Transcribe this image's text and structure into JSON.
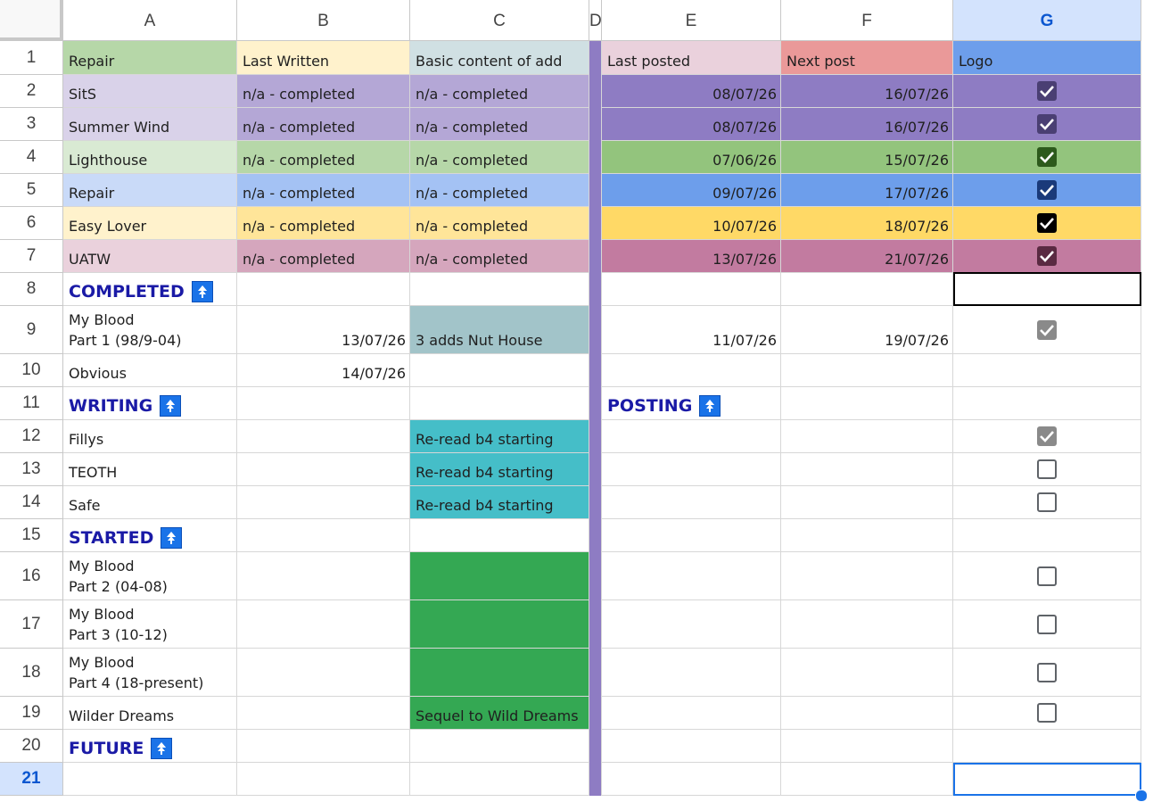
{
  "columns": [
    "A",
    "B",
    "C",
    "D",
    "E",
    "F",
    "G"
  ],
  "selected_column": "G",
  "selected_row": "21",
  "rows": [
    "1",
    "2",
    "3",
    "4",
    "5",
    "6",
    "7",
    "8",
    "9",
    "10",
    "11",
    "12",
    "13",
    "14",
    "15",
    "16",
    "17",
    "18",
    "19",
    "20",
    "21"
  ],
  "header_row": {
    "repair": "Repair",
    "last_written": "Last Written",
    "basic_content": "Basic content of add",
    "last_posted": "Last posted",
    "next_post": "Next post",
    "logo": "Logo"
  },
  "entries": [
    {
      "name": "SitS",
      "written": "n/a - completed",
      "content": "n/a - completed",
      "last_posted": "08/07/26",
      "next_post": "16/07/26",
      "logo": "checked-purple"
    },
    {
      "name": "Summer Wind",
      "written": "n/a - completed",
      "content": "n/a - completed",
      "last_posted": "08/07/26",
      "next_post": "16/07/26",
      "logo": "checked-purple"
    },
    {
      "name": "Lighthouse",
      "written": "n/a - completed",
      "content": "n/a - completed",
      "last_posted": "07/06/26",
      "next_post": "15/07/26",
      "logo": "checked-green"
    },
    {
      "name": "Repair",
      "written": "n/a - completed",
      "content": "n/a - completed",
      "last_posted": "09/07/26",
      "next_post": "17/07/26",
      "logo": "checked-blue"
    },
    {
      "name": "Easy Lover",
      "written": "n/a - completed",
      "content": "n/a - completed",
      "last_posted": "10/07/26",
      "next_post": "18/07/26",
      "logo": "checked-black"
    },
    {
      "name": "UATW",
      "written": "n/a - completed",
      "content": "n/a - completed",
      "last_posted": "13/07/26",
      "next_post": "21/07/26",
      "logo": "checked-mauve"
    }
  ],
  "sections": {
    "completed": "COMPLETED",
    "writing": "WRITING",
    "posting": "POSTING",
    "started": "STARTED",
    "future": "FUTURE"
  },
  "completed_items": [
    {
      "name": "My Blood\nPart 1 (98/9-04)",
      "written": "13/07/26",
      "content": "3 adds Nut House",
      "last_posted": "11/07/26",
      "next_post": "19/07/26"
    },
    {
      "name": "Obvious",
      "written": "14/07/26"
    }
  ],
  "writing_items": [
    {
      "name": "Fillys",
      "content": "Re-read b4 starting"
    },
    {
      "name": "TEOTH",
      "content": "Re-read b4 starting"
    },
    {
      "name": "Safe",
      "content": "Re-read b4 starting"
    }
  ],
  "started_items": [
    {
      "name": "My Blood\nPart 2 (04-08)"
    },
    {
      "name": "My Blood\nPart 3 (10-12)"
    },
    {
      "name": "My Blood\nPart 4 (18-present)"
    },
    {
      "name": "Wilder Dreams",
      "content": "Sequel to Wild Dreams"
    }
  ],
  "colors": {
    "header_green": "#b6d7a8",
    "header_yellow": "#fff2cc",
    "header_teal": "#d0e0e3",
    "header_pink": "#ead1dc",
    "header_red": "#ea9999",
    "header_blue": "#6d9eeb",
    "lavender_light": "#d9d2e9",
    "lavender": "#b4a7d6",
    "purple": "#8e7cc3",
    "green_light": "#d9ead3",
    "green": "#b6d7a8",
    "green_dark": "#93c47d",
    "blue_light": "#c9daf8",
    "blue": "#a4c2f4",
    "blue_dark": "#6d9eeb",
    "yellow_light": "#fff2cc",
    "yellow": "#ffe599",
    "yellow_dark": "#ffd966",
    "pink_light": "#ead1dc",
    "pink": "#d5a6bd",
    "pink_dark": "#c27ba0",
    "slate": "#a2c4c9",
    "cyan": "#45bec8",
    "forest": "#34a853",
    "divider": "#8e7cc3",
    "section_text": "#1a1aa6",
    "selection": "#1a73e8"
  },
  "icons": [
    "sort-ascending-icon",
    "checkbox-checked-icon",
    "checkbox-empty-icon"
  ]
}
